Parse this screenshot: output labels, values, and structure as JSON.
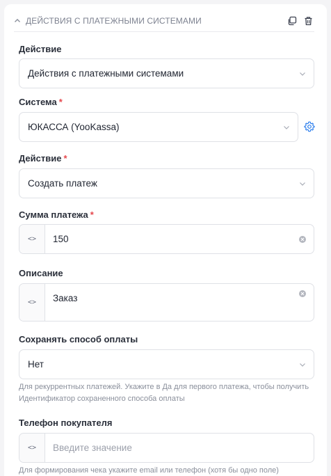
{
  "header": {
    "title": "ДЕЙСТВИЯ С ПЛАТЕЖНЫМИ СИСТЕМАМИ"
  },
  "fields": {
    "action_group": {
      "label": "Действие",
      "value": "Действия с платежными системами"
    },
    "system": {
      "label": "Система",
      "required_mark": "*",
      "value": "ЮКАССА (YooKassa)"
    },
    "action": {
      "label": "Действие",
      "required_mark": "*",
      "value": "Создать платеж"
    },
    "amount": {
      "label": "Сумма платежа",
      "required_mark": "*",
      "value": "150"
    },
    "description": {
      "label": "Описание",
      "value": "Заказ"
    },
    "save_method": {
      "label": "Сохранять способ оплаты",
      "value": "Нет",
      "hint": "Для рекуррентных платежей. Укажите в Да для первого платежа, чтобы получить Идентификатор сохраненного способа оплаты"
    },
    "phone": {
      "label": "Телефон покупателя",
      "placeholder": "Введите значение",
      "hint": "Для формирования чека укажите email или телефон (хотя бы одно поле)"
    }
  },
  "code_toggle_label": "<>",
  "colors": {
    "required": "#e5484d",
    "accent": "#2f80ed",
    "border": "#dfe1e6"
  }
}
